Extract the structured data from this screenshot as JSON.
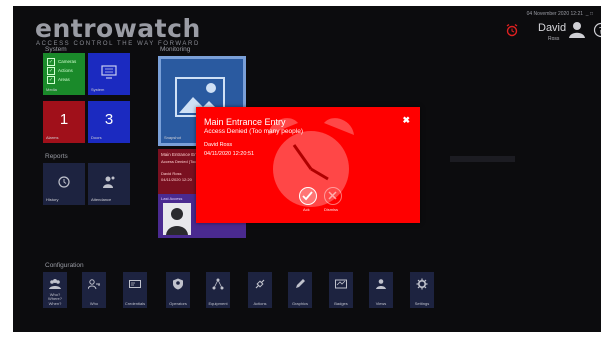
{
  "header": {
    "logo": "entrowatch",
    "tagline": "ACCESS CONTROL THE WAY FORWARD",
    "datetime": "04 November 2020 12:21",
    "user_name": "David",
    "user_role": "Ross"
  },
  "sections": {
    "system": "System",
    "monitoring": "Monitoring",
    "reports": "Reports",
    "configuration": "Configuration"
  },
  "system": {
    "checks": [
      "Cameras",
      "Actions",
      "Areas"
    ],
    "checks_tile_label": "Media",
    "system_tile_label": "System",
    "alarms_count": "1",
    "alarms_label": "Alarms",
    "doors_count": "3",
    "doors_label": "Doors"
  },
  "monitoring": {
    "image_tile_label": "Snapshot",
    "event_title": "Main Entrance Entry",
    "event_lines": [
      "Access Denied (Too many people)",
      "David Ross",
      "04/11/2020 12:20"
    ],
    "user_card_title": "Last Access"
  },
  "reports": {
    "items": [
      {
        "label": "History"
      },
      {
        "label": "Attendance"
      }
    ]
  },
  "configuration": {
    "items": [
      {
        "label": "Who? Where? When?"
      },
      {
        "label": "Who"
      },
      {
        "label": "Credentials"
      },
      {
        "label": "Operators"
      },
      {
        "label": "Equipment"
      },
      {
        "label": "Actions"
      },
      {
        "label": "Graphics"
      },
      {
        "label": "Badges"
      },
      {
        "label": "Views"
      },
      {
        "label": "Settings"
      }
    ]
  },
  "alarm_popup": {
    "title": "Main Entrance Entry",
    "message": "Access Denied (Too many people)",
    "user": "David Ross",
    "timestamp": "04/11/2020 12:20:51",
    "ack_label": "Ack",
    "dismiss_label": "Dismiss"
  },
  "colors": {
    "background": "#0c0c0e",
    "tile_blue": "#1b2ac0",
    "tile_green": "#1a8a2a",
    "tile_red": "#a0101a",
    "tile_navy": "#1d2340",
    "alarm_red": "#ff0000"
  }
}
